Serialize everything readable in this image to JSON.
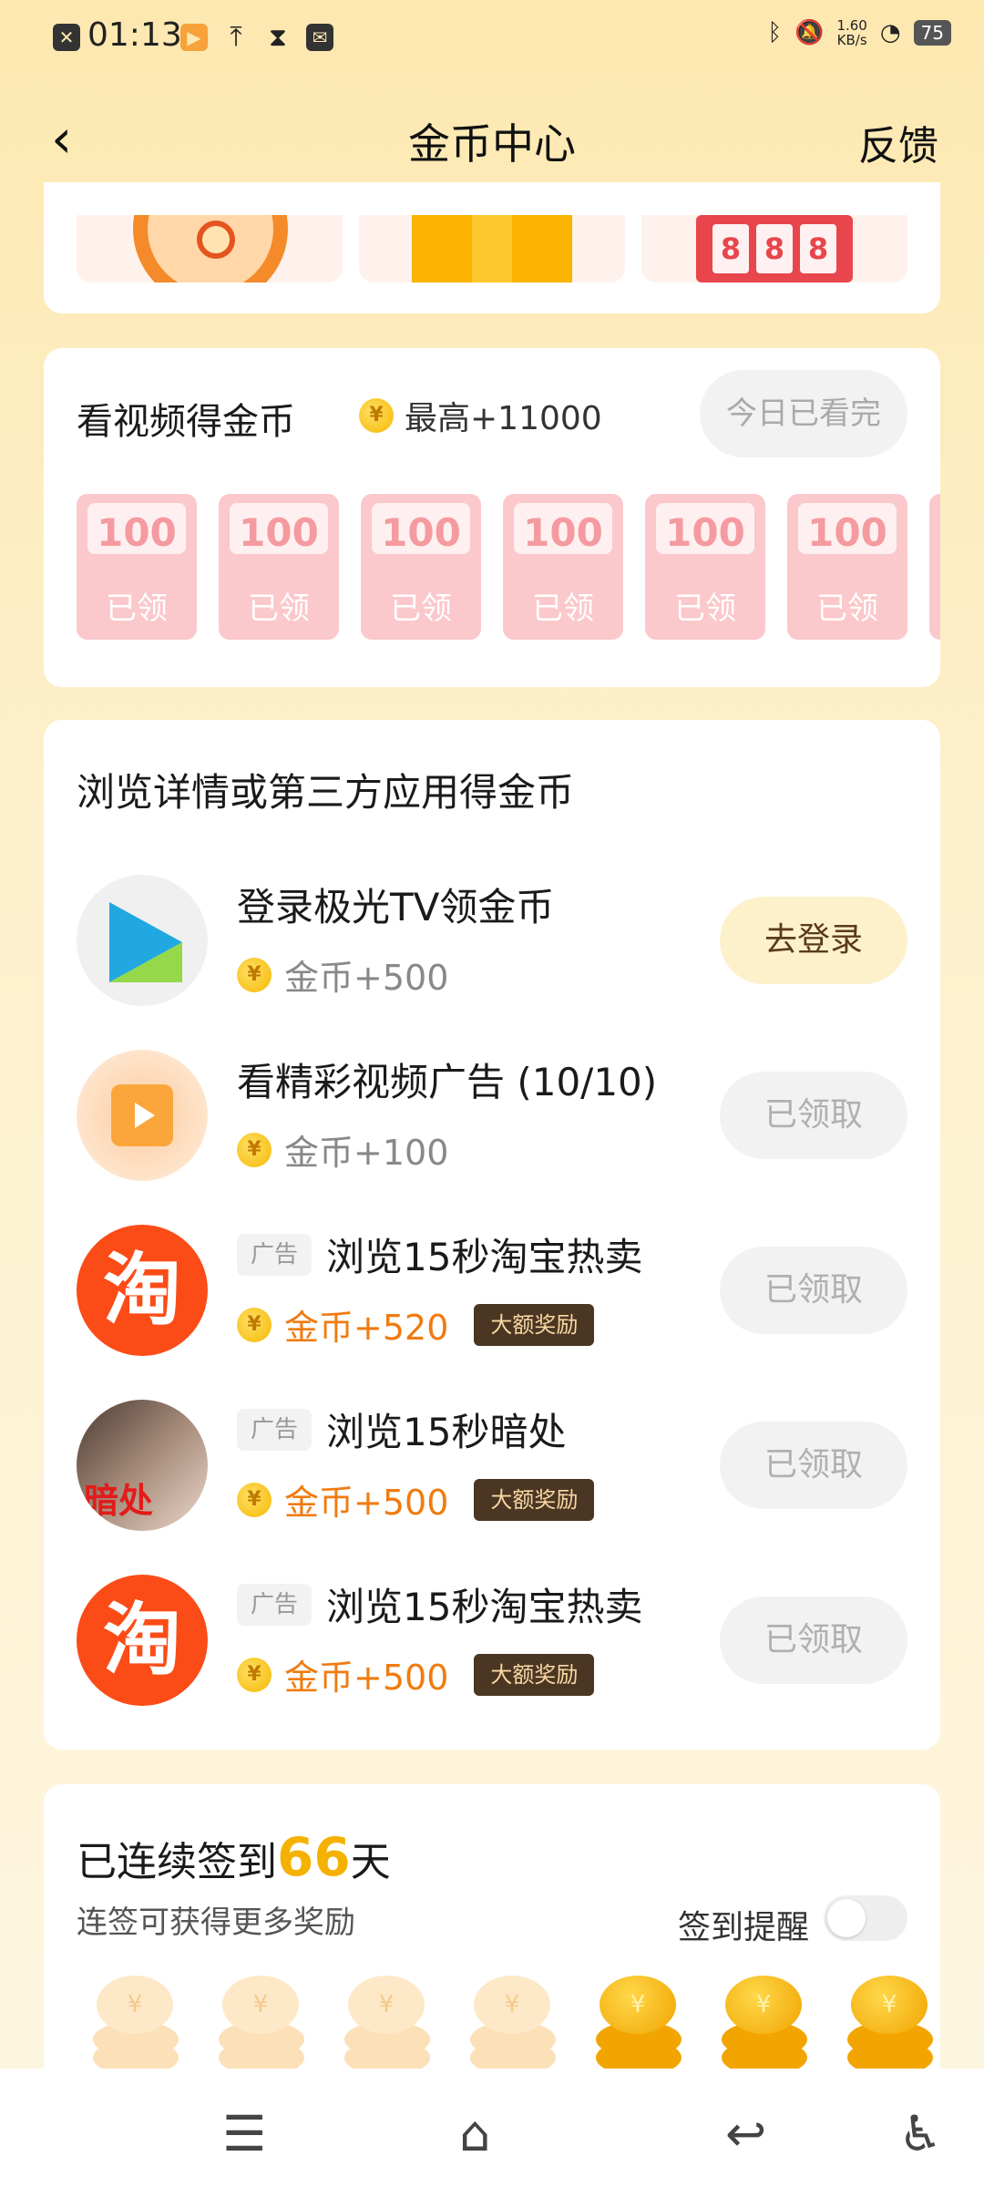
{
  "status_bar": {
    "time": "01:13",
    "net_speed": "1.60",
    "net_unit": "KB/s",
    "battery": "75"
  },
  "header": {
    "title": "金币中心",
    "feedback": "反馈"
  },
  "top_games": {
    "slot_digits": [
      "8",
      "8",
      "8"
    ]
  },
  "video_card": {
    "title": "看视频得金币",
    "max_reward": "最高+11000",
    "button": "今日已看完",
    "envelopes": [
      {
        "amount": "100",
        "status": "已领"
      },
      {
        "amount": "100",
        "status": "已领"
      },
      {
        "amount": "100",
        "status": "已领"
      },
      {
        "amount": "100",
        "status": "已领"
      },
      {
        "amount": "100",
        "status": "已领"
      },
      {
        "amount": "100",
        "status": "已领"
      }
    ]
  },
  "tasks_card": {
    "title": "浏览详情或第三方应用得金币",
    "tasks": [
      {
        "name": "登录极光TV领金币",
        "reward": "金币+500",
        "button": "去登录"
      },
      {
        "name": "看精彩视频广告 (10/10)",
        "reward": "金币+100",
        "button": "已领取"
      },
      {
        "ad_tag": "广告",
        "name": "浏览15秒淘宝热卖",
        "reward": "金币+520",
        "tag": "大额奖励",
        "button": "已领取",
        "icon_text": "淘"
      },
      {
        "ad_tag": "广告",
        "name": "浏览15秒暗处",
        "reward": "金币+500",
        "tag": "大额奖励",
        "button": "已领取",
        "icon_text": "暗处"
      },
      {
        "ad_tag": "广告",
        "name": "浏览15秒淘宝热卖",
        "reward": "金币+500",
        "tag": "大额奖励",
        "button": "已领取",
        "icon_text": "淘"
      }
    ]
  },
  "signin_card": {
    "title_prefix": "已连续签到",
    "days": "66",
    "title_suffix": "天",
    "subtitle": "连签可获得更多奖励",
    "remind_label": "签到提醒",
    "remind_on": false
  },
  "coin_symbol": "¥"
}
